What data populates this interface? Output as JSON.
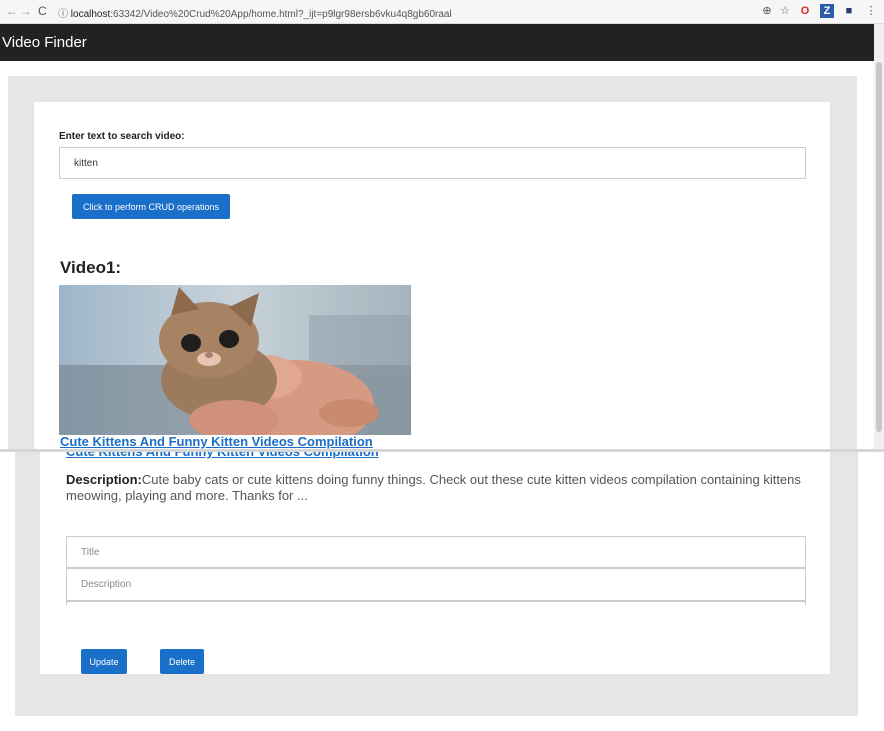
{
  "browser": {
    "url_host": "localhost",
    "url_rest": ":63342/Video%20Crud%20App/home.html?_ijt=p9lgr98ersb6vku4q8gb60raal"
  },
  "app": {
    "title": "Video Finder"
  },
  "search": {
    "label": "Enter text to search video:",
    "value": "kitten",
    "crud_button": "Click to perform CRUD operations"
  },
  "video": {
    "heading": "Video1:",
    "link_text": "Cute Kittens And Funny Kitten Videos Compilation",
    "description_label": "Description:",
    "description_text": "Cute baby cats or cute kittens doing funny things. Check out these cute kitten videos compilation containing kittens meowing, playing and more. Thanks for ..."
  },
  "form": {
    "title_placeholder": "Title",
    "description_placeholder": "Description",
    "update_button": "Update",
    "delete_button": "Delete"
  },
  "colors": {
    "navbar": "#222222",
    "accent": "#1a6fc9"
  }
}
